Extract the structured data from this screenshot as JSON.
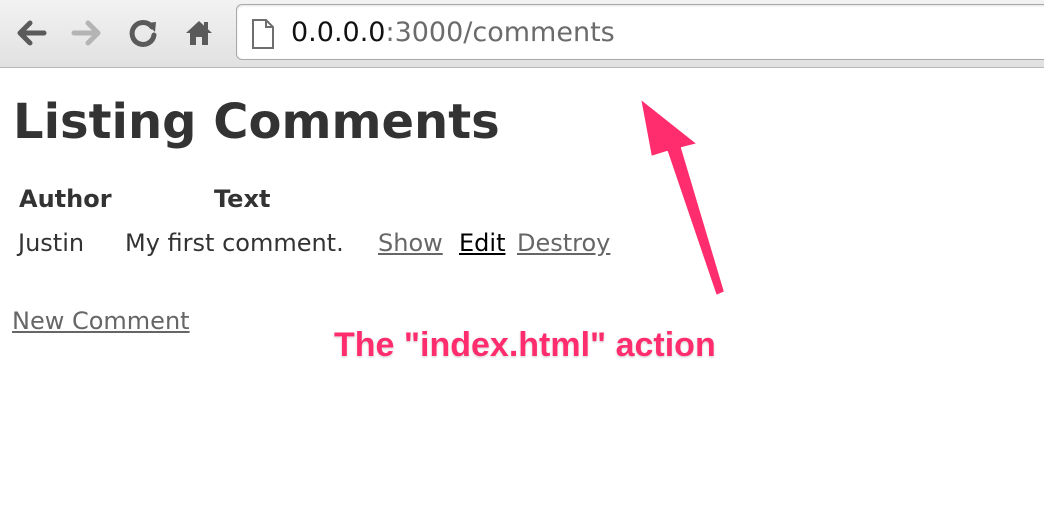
{
  "browser": {
    "url_host": "0.0.0.0",
    "url_path": ":3000/comments",
    "icons": {
      "back": "back-arrow-icon",
      "forward": "forward-arrow-icon",
      "reload": "reload-icon",
      "home": "home-icon",
      "page": "page-icon"
    }
  },
  "page": {
    "title": "Listing Comments",
    "table": {
      "headers": [
        "Author",
        "Text"
      ],
      "rows": [
        {
          "author": "Justin",
          "text": "My first comment.",
          "actions": [
            "Show",
            "Edit",
            "Destroy"
          ]
        }
      ]
    },
    "new_link": "New Comment"
  },
  "annotation": {
    "text": "The \"index.html\" action",
    "color": "#ff2d6e"
  },
  "colors": {
    "heading": "#333333",
    "link": "#666666",
    "visited_link": "#000000",
    "toolbar": "#e8e8e8"
  }
}
